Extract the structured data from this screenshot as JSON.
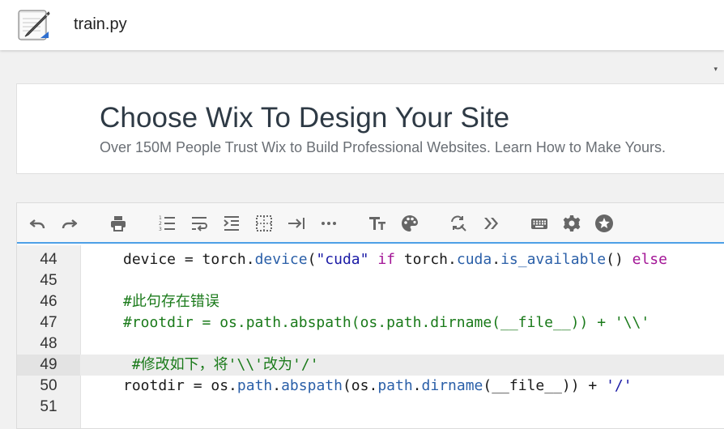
{
  "header": {
    "file_name": "train.py"
  },
  "ad": {
    "marker": "▾",
    "headline": "Choose Wix To Design Your Site",
    "subline": "Over 150M People Trust Wix to Build Professional Websites. Learn How to Make Yours."
  },
  "toolbar": {
    "buttons": [
      "undo",
      "redo",
      "print",
      "numbered-list",
      "wrap",
      "indent",
      "select-all",
      "tab",
      "more",
      "font-size",
      "palette",
      "find-replace",
      "forward",
      "keyboard",
      "settings",
      "star"
    ]
  },
  "colors": {
    "accent": "#4da0e6",
    "keyword": "#a31596",
    "string": "#1a1aa6",
    "comment": "#1a7a1a"
  },
  "code": {
    "lines": [
      {
        "num": "44",
        "parts": [
          [
            "plain",
            "device = torch."
          ],
          [
            "attr",
            "device"
          ],
          [
            "plain",
            "("
          ],
          [
            "str",
            "\"cuda\""
          ],
          [
            "plain",
            " "
          ],
          [
            "kw",
            "if"
          ],
          [
            "plain",
            " torch."
          ],
          [
            "attr",
            "cuda"
          ],
          [
            "plain",
            "."
          ],
          [
            "attr",
            "is_available"
          ],
          [
            "plain",
            "() "
          ],
          [
            "kw",
            "else"
          ]
        ]
      },
      {
        "num": "45",
        "parts": []
      },
      {
        "num": "46",
        "parts": [
          [
            "cmt",
            "#此句存在错误"
          ]
        ]
      },
      {
        "num": "47",
        "parts": [
          [
            "cmt",
            "#rootdir = os.path.abspath(os.path.dirname(__file__)) + '\\\\'"
          ]
        ]
      },
      {
        "num": "48",
        "parts": []
      },
      {
        "num": "49",
        "active": true,
        "parts": [
          [
            "cmt",
            " #修改如下，将'\\\\'改为'/'"
          ]
        ]
      },
      {
        "num": "50",
        "parts": [
          [
            "plain",
            "rootdir = os."
          ],
          [
            "attr",
            "path"
          ],
          [
            "plain",
            "."
          ],
          [
            "attr",
            "abspath"
          ],
          [
            "plain",
            "(os."
          ],
          [
            "attr",
            "path"
          ],
          [
            "plain",
            "."
          ],
          [
            "attr",
            "dirname"
          ],
          [
            "plain",
            "(__file__)) + "
          ],
          [
            "str",
            "'/'"
          ]
        ]
      },
      {
        "num": "51",
        "parts": []
      }
    ]
  }
}
